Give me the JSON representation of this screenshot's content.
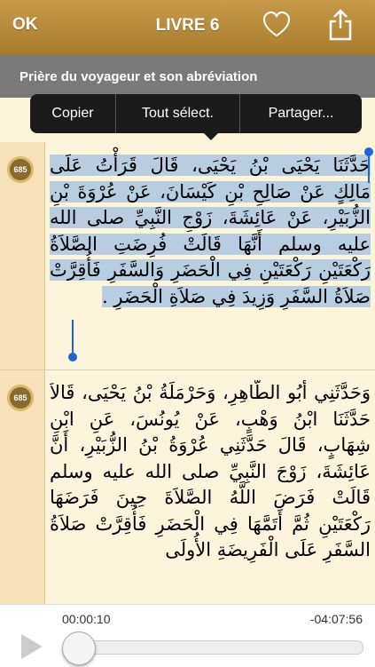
{
  "topbar": {
    "ok_label": "OK",
    "title": "LIVRE 6"
  },
  "subheader": {
    "chapter_title": "Prière du voyageur et son abréviation"
  },
  "context_menu": {
    "items": [
      "Copier",
      "Tout sélect.",
      "Partager..."
    ]
  },
  "hadiths": [
    {
      "number": "685",
      "text": "حَدَّثَنَا يَحْيَى بْنُ يَحْيَى، قَالَ قَرَأْتُ عَلَى مَالِكٍ عَنْ صَالِحِ بْنِ كَيْسَانَ، عَنْ عُرْوَةَ بْنِ الزُّبَيْرِ، عَنْ عَائِشَةَ، زَوْجِ النَّبِيِّ صلى الله عليه وسلم أَنَّهَا قَالَتْ فُرِضَتِ الصَّلاَةُ رَكْعَتَيْنِ رَكْعَتَيْنِ فِي الْحَضَرِ وَالسَّفَرِ فَأُقِرَّتْ صَلاَةُ السَّفَرِ وَزِيدَ فِي صَلاَةِ الْحَضَرِ ."
    },
    {
      "number": "685",
      "text": "وَحَدَّثَنِي أَبُو الطَّاهِرِ، وَحَرْمَلَةُ بْنُ يَحْيَى، قَالاَ حَدَّثَنَا ابْنُ وَهْبٍ، عَنْ يُونُسَ، عَنِ ابْنِ شِهَابٍ، قَالَ حَدَّثَنِي عُرْوَةُ بْنُ الزُّبَيْرِ، أَنَّ عَائِشَةَ، زَوْجَ النَّبِيِّ صلى الله عليه وسلم قَالَتْ فَرَضَ اللَّهُ الصَّلاَةَ حِينَ فَرَضَهَا رَكْعَتَيْنِ ثُمَّ أَتَمَّهَا فِي الْحَضَرِ فَأُقِرَّتْ صَلاَةُ السَّفَرِ عَلَى الْفَرِيضَةِ الأُولَى"
    }
  ],
  "player": {
    "elapsed": "00:00:10",
    "remaining": "-04:07:56",
    "progress_fraction": 0.04
  }
}
